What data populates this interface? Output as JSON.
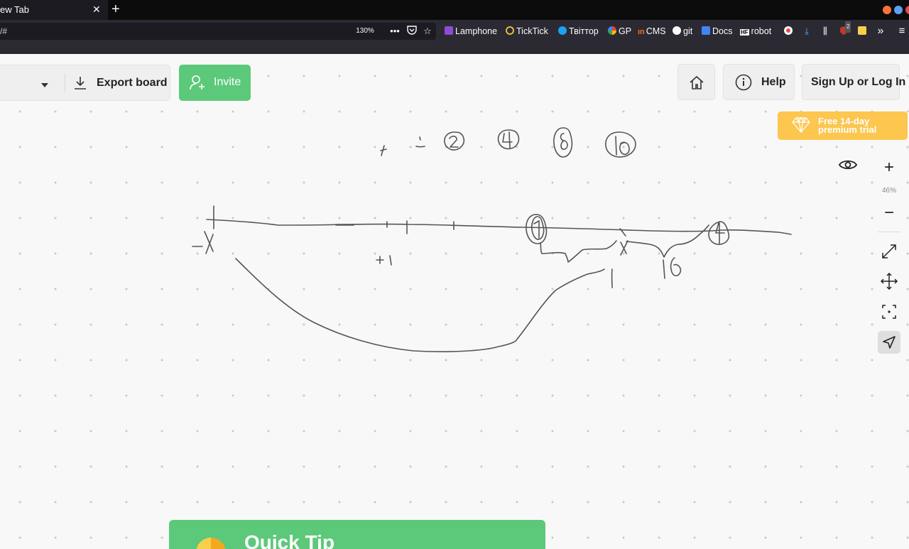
{
  "browser": {
    "tab_title": "ew Tab",
    "tab_close": "✕",
    "new_tab": "+",
    "url": "/#",
    "zoom": "130%",
    "bookmarks": [
      {
        "label": "Lamphone",
        "color": "#8e4cd6"
      },
      {
        "label": "TickTick",
        "color": "#e8b64a"
      },
      {
        "label": "Твіттор",
        "color": "#1da1f2"
      },
      {
        "label": "GP",
        "color": "#34a853"
      },
      {
        "label": "CMS",
        "color": "#f36f21"
      },
      {
        "label": "git",
        "color": "#ffffff"
      },
      {
        "label": "Docs",
        "color": "#4285f4"
      },
      {
        "label": "robot",
        "color": "#ffffff"
      }
    ],
    "bm_prefix_cms": "ın",
    "bm_prefix_robot": "HF",
    "ext_badge": "2"
  },
  "toolbar": {
    "export_label": "Export board",
    "invite_label": "Invite",
    "help_label": "Help",
    "signup_label": "Sign Up or Log In",
    "premium_label": "Free 14-day premium trial"
  },
  "zoom_panel": {
    "zoom_in": "+",
    "zoom_level": "46%",
    "zoom_out": "−"
  },
  "quick_tip": {
    "title": "Quick Tip"
  },
  "colors": {
    "accent_green": "#5cc97a",
    "premium_yellow": "#fcc64f",
    "ink": "#555555"
  }
}
